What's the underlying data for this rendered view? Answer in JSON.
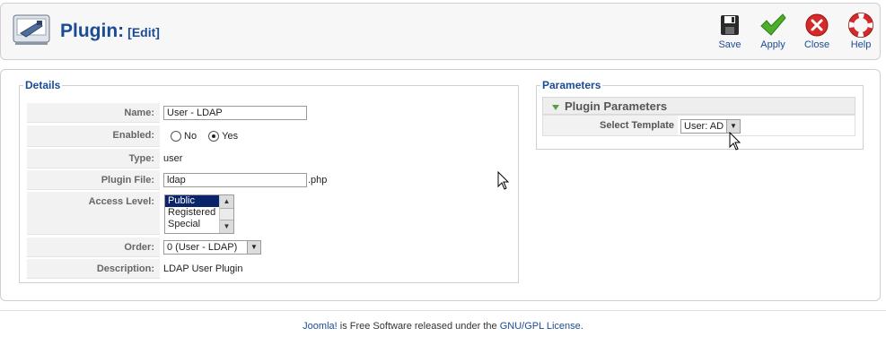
{
  "header": {
    "title": "Plugin:",
    "subtitle": "[Edit]"
  },
  "toolbar": {
    "save": "Save",
    "apply": "Apply",
    "close": "Close",
    "help": "Help"
  },
  "details": {
    "legend": "Details",
    "name": {
      "label": "Name:",
      "value": "User - LDAP"
    },
    "enabled": {
      "label": "Enabled:",
      "no": "No",
      "yes": "Yes",
      "selected": "Yes"
    },
    "type": {
      "label": "Type:",
      "value": "user"
    },
    "plugin_file": {
      "label": "Plugin File:",
      "value": "ldap",
      "suffix": ".php"
    },
    "access": {
      "label": "Access Level:",
      "options": [
        "Public",
        "Registered",
        "Special"
      ],
      "selected": "Public"
    },
    "order": {
      "label": "Order:",
      "value": "0 (User - LDAP)"
    },
    "description": {
      "label": "Description:",
      "value": "LDAP User Plugin"
    }
  },
  "parameters": {
    "legend": "Parameters",
    "section_title": "Plugin Parameters",
    "select_template": {
      "label": "Select Template",
      "value": "User: AD"
    }
  },
  "footer": {
    "link1": "Joomla!",
    "text": " is Free Software released under the ",
    "link2": "GNU/GPL License",
    "end": "."
  },
  "colors": {
    "accent": "#1a4b95",
    "apply_green": "#4caf2c",
    "close_red": "#d42a2a"
  }
}
